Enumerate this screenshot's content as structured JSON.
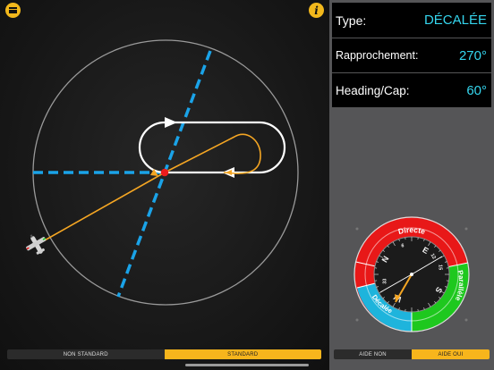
{
  "header": {
    "menu_icon": "hamburger-menu-icon",
    "info_icon": "info-icon",
    "info_glyph": "i"
  },
  "panel": {
    "type_label": "Type:",
    "type_value": "DÉCALÉE",
    "rapprochement_label": "Rapprochement:",
    "rapprochement_value": "270°",
    "heading_label": "Heading/Cap:",
    "heading_value": "60°"
  },
  "dial": {
    "sectors": [
      "Directe",
      "Parallèle",
      "Décalée"
    ],
    "cardinals": [
      "N",
      "E",
      "S",
      "W"
    ],
    "numbers": [
      "33",
      "15",
      "12",
      "6"
    ],
    "colors": {
      "directe": "#e81818",
      "parallele": "#1ec81e",
      "decalee": "#1eb4dc"
    }
  },
  "toggles": {
    "standard": [
      {
        "label": "NON STANDARD",
        "active": false
      },
      {
        "label": "STANDARD",
        "active": true
      }
    ],
    "aide": [
      {
        "label": "AIDE NON",
        "active": false
      },
      {
        "label": "AIDE OUI",
        "active": true
      }
    ]
  },
  "colors": {
    "accent": "#f7b51c",
    "value_text": "#35d6ee",
    "inbound_dashed": "#1aa3e8",
    "track": "#f5a623",
    "fix": "#ee1c1c"
  }
}
